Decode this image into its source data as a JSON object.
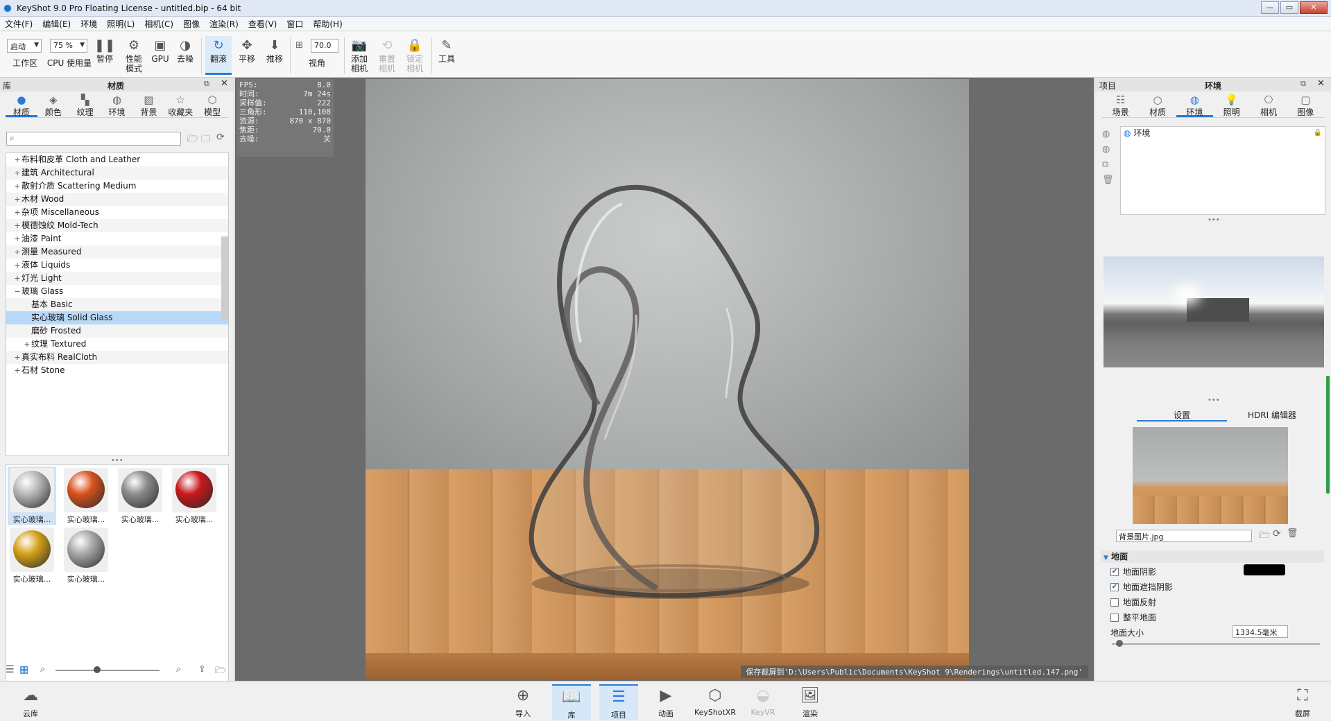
{
  "window": {
    "title": "KeyShot 9.0 Pro Floating License  - untitled.bip  - 64 bit"
  },
  "menu": [
    "文件(F)",
    "编辑(E)",
    "环境",
    "照明(L)",
    "相机(C)",
    "图像",
    "渲染(R)",
    "查看(V)",
    "窗口",
    "帮助(H)"
  ],
  "toolbar": {
    "workspace_value": "启动",
    "workspace_label": "工作区",
    "cpu_value": "75 %",
    "cpu_label": "CPU 使用量",
    "pause_label": "暂停",
    "performance_label": "性能\n模式",
    "gpu_label": "GPU",
    "denoise_label": "去噪",
    "tumble_label": "翻滚",
    "pan_label": "平移",
    "dolly_label": "推移",
    "fov_value": "70.0",
    "fov_label": "视角",
    "add_camera_label": "添加\n相机",
    "reset_camera_label": "重置\n相机",
    "lock_camera_label": "锁定\n相机",
    "tools_label": "工具"
  },
  "library": {
    "panel_left": "库",
    "panel_title": "材质",
    "tabs": [
      "材质",
      "颜色",
      "纹理",
      "环境",
      "背景",
      "收藏夹",
      "模型"
    ],
    "tree": [
      {
        "label": "布料和皮革 Cloth and Leather",
        "pm": "+",
        "indent": 0
      },
      {
        "label": "建筑 Architectural",
        "pm": "+",
        "indent": 0
      },
      {
        "label": "散射介质 Scattering Medium",
        "pm": "+",
        "indent": 0
      },
      {
        "label": "木材 Wood",
        "pm": "+",
        "indent": 0
      },
      {
        "label": "杂项 Miscellaneous",
        "pm": "+",
        "indent": 0
      },
      {
        "label": "模德蚀纹 Mold-Tech",
        "pm": "+",
        "indent": 0
      },
      {
        "label": "油漆 Paint",
        "pm": "+",
        "indent": 0
      },
      {
        "label": "测量 Measured",
        "pm": "+",
        "indent": 0
      },
      {
        "label": "液体 Liquids",
        "pm": "+",
        "indent": 0
      },
      {
        "label": "灯光 Light",
        "pm": "+",
        "indent": 0
      },
      {
        "label": "玻璃 Glass",
        "pm": "−",
        "indent": 0
      },
      {
        "label": "基本 Basic",
        "pm": "",
        "indent": 1
      },
      {
        "label": "实心玻璃 Solid Glass",
        "pm": "",
        "indent": 1
      },
      {
        "label": "磨砂 Frosted",
        "pm": "",
        "indent": 1
      },
      {
        "label": "纹理 Textured",
        "pm": "+",
        "indent": 1
      },
      {
        "label": "真实布料 RealCloth",
        "pm": "+",
        "indent": 0
      },
      {
        "label": "石材 Stone",
        "pm": "+",
        "indent": 0
      }
    ],
    "selected_index": 12,
    "thumbnails": [
      {
        "label": "实心玻璃...",
        "color": "#b9b9b9"
      },
      {
        "label": "实心玻璃...",
        "color": "#d8521c"
      },
      {
        "label": "实心玻璃...",
        "color": "#8c8c8c"
      },
      {
        "label": "实心玻璃...",
        "color": "#c8181c"
      },
      {
        "label": "实心玻璃...",
        "color": "#d4a21a"
      },
      {
        "label": "实心玻璃...",
        "color": "#a8a8a8"
      }
    ]
  },
  "viewport": {
    "hud": [
      {
        "k": "FPS:",
        "v": "8.0"
      },
      {
        "k": "时间:",
        "v": "7m 24s"
      },
      {
        "k": "采样值:",
        "v": "222"
      },
      {
        "k": "三角形:",
        "v": "110,108"
      },
      {
        "k": "资源:",
        "v": "870 x 870"
      },
      {
        "k": "焦距:",
        "v": "70.0"
      },
      {
        "k": "去噪:",
        "v": "关"
      }
    ],
    "save_status": "保存截屏到'D:\\Users\\Public\\Documents\\KeyShot 9\\Renderings\\untitled.147.png'"
  },
  "project": {
    "panel_left": "项目",
    "panel_title": "环境",
    "tabs": [
      "场景",
      "材质",
      "环境",
      "照明",
      "相机",
      "图像"
    ],
    "env_item": "环境",
    "subtabs": [
      "设置",
      "HDRI 编辑器"
    ],
    "bg_image": "背景图片.jpg",
    "ground_section": "地面",
    "options": [
      {
        "label": "地面阴影",
        "checked": true
      },
      {
        "label": "地面遮挡阴影",
        "checked": true
      },
      {
        "label": "地面反射",
        "checked": false
      },
      {
        "label": "整平地面",
        "checked": false
      }
    ],
    "ground_size_label": "地面大小",
    "ground_size_value": "1334.5毫米",
    "shadow_color": "#000000"
  },
  "bottombar": {
    "cloud_label": "云库",
    "import_label": "导入",
    "library_label": "库",
    "project_label": "项目",
    "animation_label": "动画",
    "keyshotxr_label": "KeyShotXR",
    "keyvr_label": "KeyVR",
    "render_label": "渲染",
    "screenshot_label": "截屏"
  }
}
